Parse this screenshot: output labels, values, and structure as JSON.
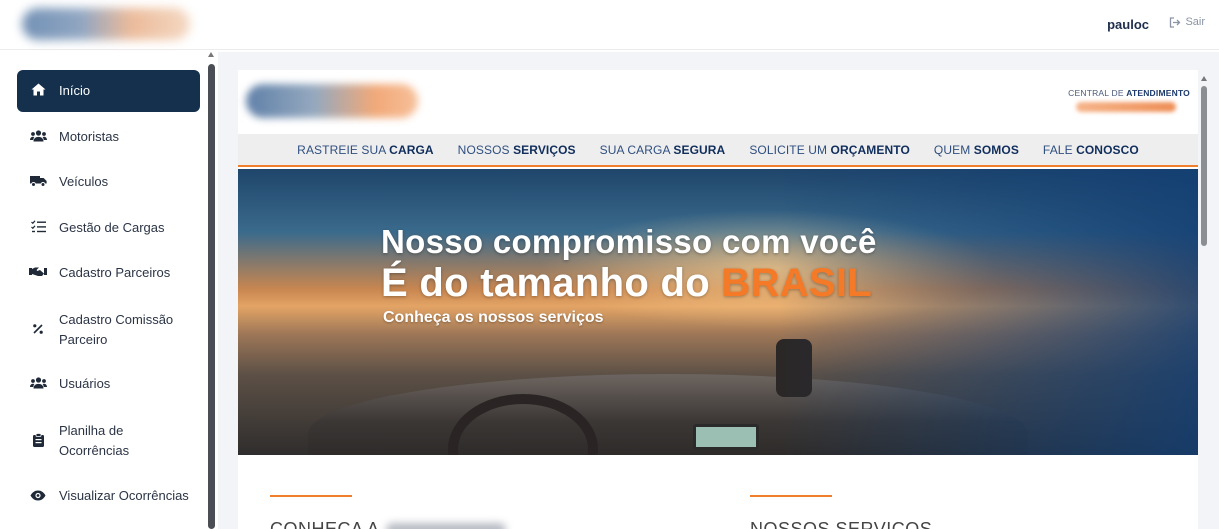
{
  "header": {
    "user": "pauloc",
    "logout_label": "Sair"
  },
  "sidebar": {
    "items": [
      {
        "label": "Início",
        "icon": "home-icon"
      },
      {
        "label": "Motoristas",
        "icon": "users-icon"
      },
      {
        "label": "Veículos",
        "icon": "truck-icon"
      },
      {
        "label": "Gestão de Cargas",
        "icon": "list-check-icon"
      },
      {
        "label": "Cadastro Parceiros",
        "icon": "handshake-icon"
      },
      {
        "label": "Cadastro Comissão",
        "label2": "Parceiro",
        "icon": "percent-icon"
      },
      {
        "label": "Usuários",
        "icon": "users-icon"
      },
      {
        "label": "Planilha de",
        "label2": "Ocorrências",
        "icon": "clipboard-icon"
      },
      {
        "label": "Visualizar Ocorrências",
        "icon": "eye-icon"
      }
    ]
  },
  "site": {
    "central": "CENTRAL DE",
    "central_bold": "ATENDIMENTO",
    "nav": [
      {
        "a": "RASTREIE SUA ",
        "b": "CARGA"
      },
      {
        "a": "NOSSOS ",
        "b": "SERVIÇOS"
      },
      {
        "a": "SUA CARGA ",
        "b": "SEGURA"
      },
      {
        "a": "SOLICITE UM ",
        "b": "ORÇAMENTO"
      },
      {
        "a": "QUEM ",
        "b": "SOMOS"
      },
      {
        "a": "FALE ",
        "b": "CONOSCO"
      }
    ],
    "hero": {
      "line1": "Nosso compromisso com você",
      "line2": "É do tamanho do ",
      "line2_highlight": "BRASIL",
      "line3": "Conheça os nossos serviços"
    },
    "sections": [
      {
        "title": "CONHEÇA A"
      },
      {
        "title": "NOSSOS SERVIÇOS"
      }
    ]
  },
  "colors": {
    "primary": "#14304d",
    "accent": "#f07f2d",
    "nav_text": "#2f4f80"
  }
}
